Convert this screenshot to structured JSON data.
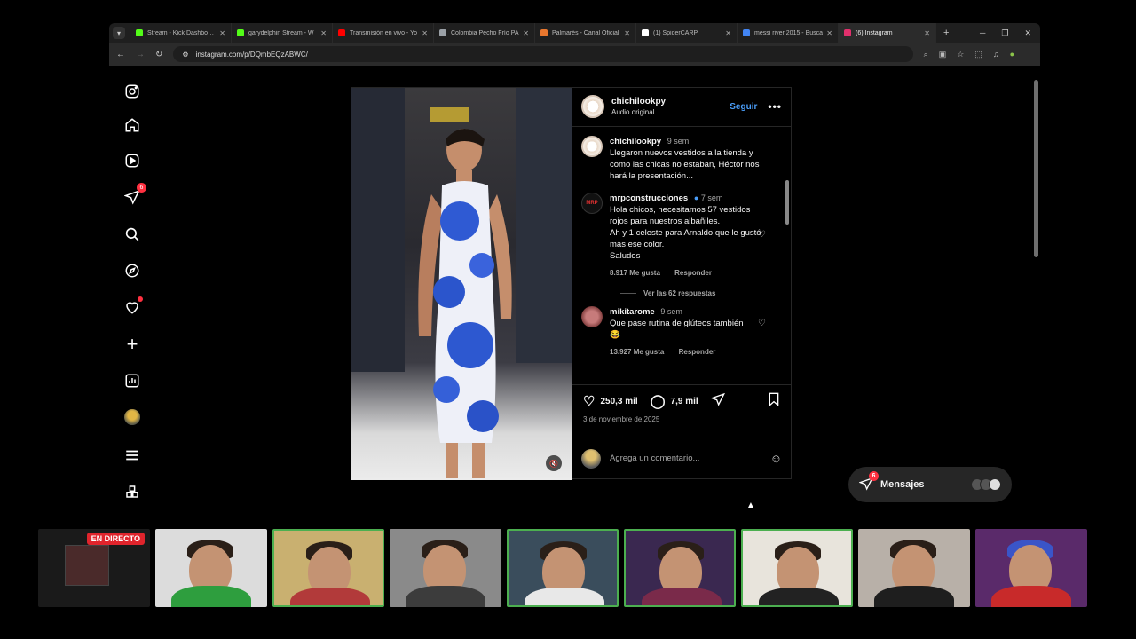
{
  "browser": {
    "tabs": [
      {
        "title": "Stream - Kick Dashboard",
        "favicon_color": "#53fc18"
      },
      {
        "title": "garydelphin Stream - W",
        "favicon_color": "#53fc18"
      },
      {
        "title": "Transmisión en vivo - Yo",
        "favicon_color": "#ff0000"
      },
      {
        "title": "Colombia Pecho Frío PA",
        "favicon_color": "#9aa0a6"
      },
      {
        "title": "Palmarés - Canal Oficial",
        "favicon_color": "#e8772e"
      },
      {
        "title": "(1) SpiderCARP",
        "favicon_color": "#ffffff"
      },
      {
        "title": "messi river 2015 - Busca",
        "favicon_color": "#4285f4"
      },
      {
        "title": "(6) Instagram",
        "favicon_color": "#e1306c"
      }
    ],
    "new_tab": "+",
    "url": "instagram.com/p/DQmbEQzABWC/"
  },
  "sidebar": {
    "notifications_badge": "6"
  },
  "post": {
    "username": "chichilookpy",
    "audio": "Audio original",
    "follow_label": "Seguir",
    "more": "•••",
    "caption": {
      "user": "chichilookpy",
      "time": "9 sem",
      "text": "Llegaron nuevos vestidos a la tienda y como las chicas no estaban, Héctor nos hará la presentación..."
    },
    "comments": [
      {
        "user": "mrpconstrucciones",
        "time": "7 sem",
        "lines": [
          "Hola chicos, necesitamos 57 vestidos rojos para nuestros albañiles.",
          "Ah y 1 celeste para Arnaldo que le gustó más ese color.",
          "Saludos"
        ],
        "likes": "8.917 Me gusta",
        "reply": "Responder",
        "view_replies": "Ver las 62 respuestas"
      },
      {
        "user": "mikitarome",
        "time": "9 sem",
        "lines": [
          "Que pase rutina de glúteos también",
          "😂"
        ],
        "likes": "13.927 Me gusta",
        "reply": "Responder"
      }
    ],
    "likes": "250,3 mil",
    "comments_count": "7,9 mil",
    "date": "3 de noviembre de 2025",
    "comment_placeholder": "Agrega un comentario..."
  },
  "messages": {
    "label": "Mensajes",
    "badge": "6"
  },
  "stream": {
    "live_label": "EN DIRECTO"
  }
}
